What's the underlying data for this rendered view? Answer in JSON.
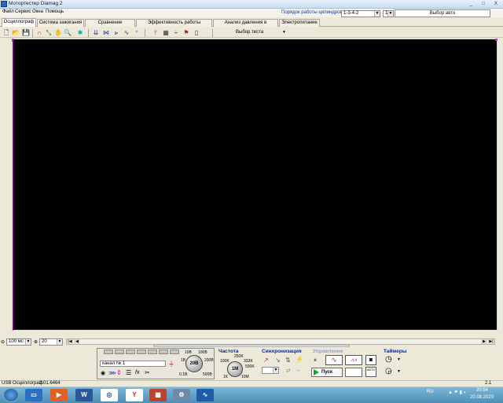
{
  "window": {
    "title": "Мотортестер Diamag 2",
    "min": "_",
    "max": "□",
    "close": "X"
  },
  "menu": [
    "Файл",
    "Сервис",
    "Окна",
    "Помощь"
  ],
  "cylinders": {
    "label": "Порядок работы цилиндров",
    "order": "1-3-4-2",
    "count": "1"
  },
  "auto_select": "Выбор авто",
  "tabs": [
    "Осциллограф",
    "Система зажигания",
    "Сравнение цилиндров",
    "Эффективность работы цилиндров",
    "Анализ давления в цилиндре",
    "Электропитание"
  ],
  "test_select": "Выбор теста",
  "timebase": {
    "value": "100 мс",
    "zoom": "20"
  },
  "channel": {
    "name": "канал № 1"
  },
  "knob_voltage": {
    "center": "20В",
    "marks": [
      "10В",
      "100В",
      "1В",
      "200В",
      "0.1В",
      "500В"
    ]
  },
  "frequency": {
    "title": "Частота",
    "center": "1M",
    "marks": [
      "250K",
      "100K",
      "333K",
      "500K",
      "1K",
      "10M"
    ]
  },
  "sync": {
    "title": "Синхронизация"
  },
  "control": {
    "title": "Управление",
    "run": "Пуск",
    "auto": "АВТО"
  },
  "timers": {
    "title": "Таймеры"
  },
  "status": {
    "left": "USB Осциллограф",
    "version": "2.01.6464",
    "right": "2.1"
  },
  "taskbar": {
    "lang": "RU",
    "time": "20:54",
    "date": "20.08.2020"
  },
  "colors": {
    "scope_bg": "#000000",
    "trace": "#c22bd0",
    "accent": "#0b2a94"
  }
}
